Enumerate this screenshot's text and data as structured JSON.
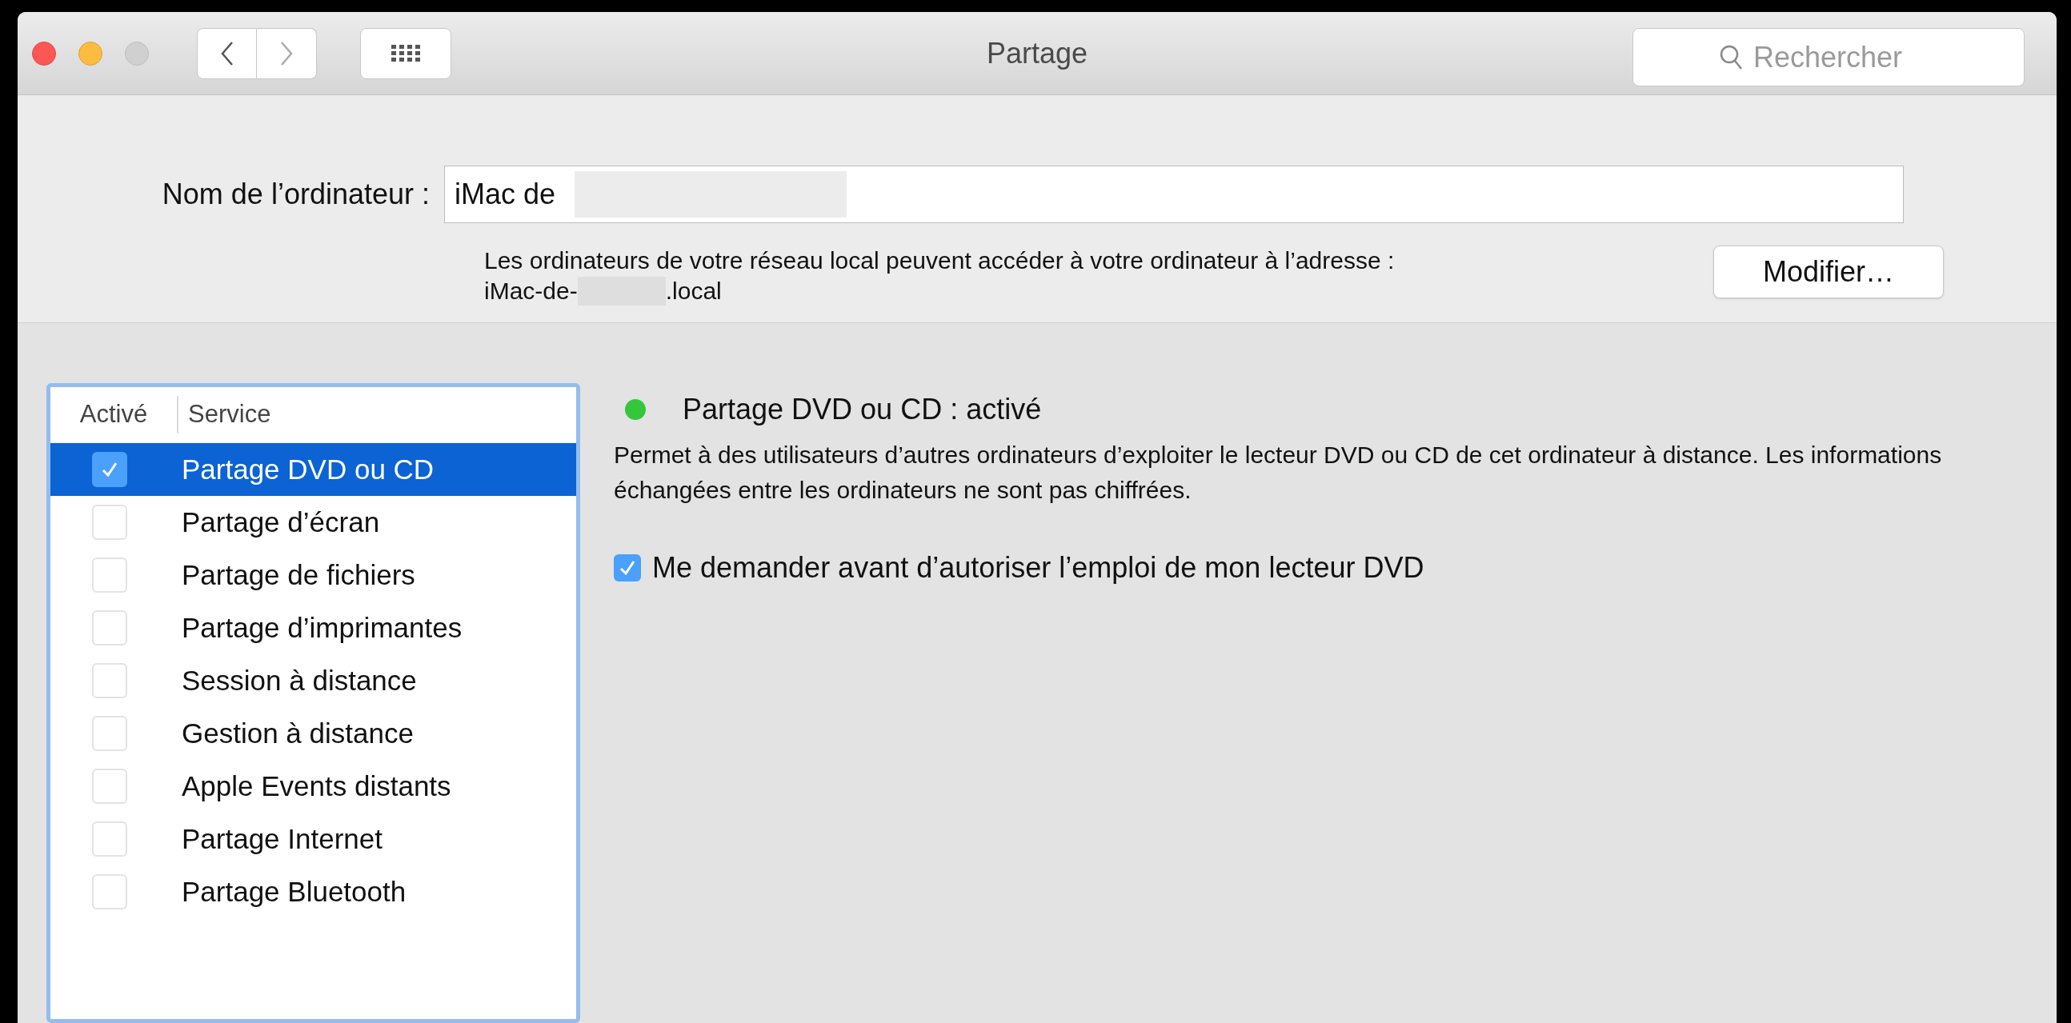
{
  "window": {
    "title": "Partage"
  },
  "search": {
    "placeholder": "Rechercher"
  },
  "computer_name": {
    "label": "Nom de l’ordinateur :",
    "value": "iMac de"
  },
  "address": {
    "text": "Les ordinateurs de votre réseau local peuvent accéder à votre ordinateur à l’adresse :",
    "host_prefix": "iMac-de-",
    "host_suffix": ".local"
  },
  "modify_button": "Modifier…",
  "services": {
    "columns": [
      "Activé",
      "Service"
    ],
    "rows": [
      {
        "name": "Partage DVD ou CD",
        "checked": true,
        "selected": true
      },
      {
        "name": "Partage d’écran",
        "checked": false,
        "selected": false
      },
      {
        "name": "Partage de fichiers",
        "checked": false,
        "selected": false
      },
      {
        "name": "Partage d’imprimantes",
        "checked": false,
        "selected": false
      },
      {
        "name": "Session à distance",
        "checked": false,
        "selected": false
      },
      {
        "name": "Gestion à distance",
        "checked": false,
        "selected": false
      },
      {
        "name": "Apple Events distants",
        "checked": false,
        "selected": false
      },
      {
        "name": "Partage Internet",
        "checked": false,
        "selected": false
      },
      {
        "name": "Partage Bluetooth",
        "checked": false,
        "selected": false
      }
    ]
  },
  "detail": {
    "status": "Partage DVD ou CD : activé",
    "color": "#34c73b",
    "description": "Permet à des utilisateurs d’autres ordinateurs d’exploiter le lecteur DVD ou CD de cet ordinateur à distance. Les informations échangées entre les ordinateurs ne sont pas chiffrées.",
    "option": {
      "label": "Me demander avant d’autoriser l’emploi de mon lecteur DVD",
      "checked": true
    }
  }
}
